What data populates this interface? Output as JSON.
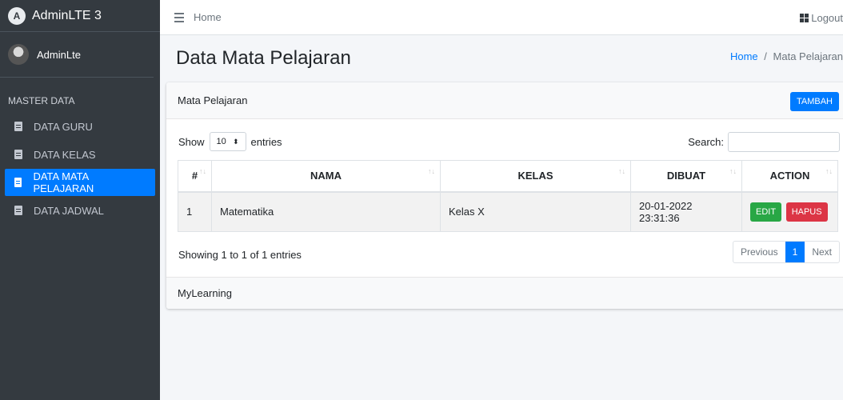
{
  "brand": {
    "logo": "A",
    "title": "AdminLTE 3"
  },
  "user": {
    "name": "AdminLte"
  },
  "sidebar": {
    "header": "MASTER DATA",
    "items": [
      {
        "label": "DATA GURU",
        "icon": "clipboard-icon"
      },
      {
        "label": "DATA KELAS",
        "icon": "clipboard-icon"
      },
      {
        "label": "DATA MATA PELAJARAN",
        "icon": "clipboard-icon",
        "active": true
      },
      {
        "label": "DATA JADWAL",
        "icon": "clipboard-icon"
      }
    ]
  },
  "topbar": {
    "home": "Home",
    "logout": "Logout"
  },
  "page": {
    "title": "Data Mata Pelajaran"
  },
  "breadcrumb": {
    "home": "Home",
    "sep": "/",
    "current": "Mata Pelajaran"
  },
  "card": {
    "title": "Mata Pelajaran",
    "add_button": "TAMBAH",
    "show_label": "Show",
    "entries_value": "10",
    "entries_label": "entries",
    "search_label": "Search:",
    "info": "Showing 1 to 1 of 1 entries",
    "footer": "MyLearning"
  },
  "table": {
    "headers": [
      "#",
      "NAMA",
      "KELAS",
      "DIBUAT",
      "ACTION"
    ],
    "rows": [
      {
        "no": "1",
        "nama": "Matematika",
        "kelas": "Kelas X",
        "dibuat": "20-01-2022 23:31:36",
        "edit": "EDIT",
        "hapus": "HAPUS"
      }
    ]
  },
  "pagination": {
    "previous": "Previous",
    "current": "1",
    "next": "Next"
  },
  "colors": {
    "primary": "#007bff",
    "success": "#28a745",
    "danger": "#dc3545",
    "sidebar": "#343a40"
  }
}
